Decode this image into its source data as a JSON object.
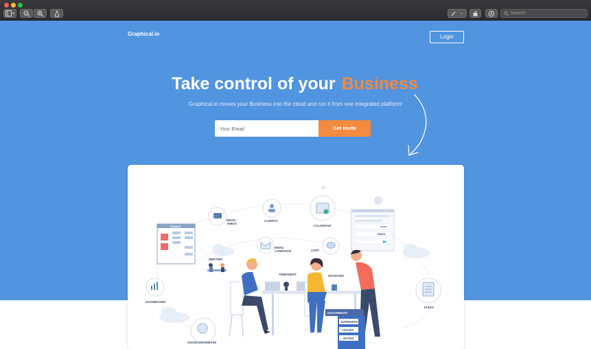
{
  "toolbar": {
    "search_placeholder": "Search"
  },
  "header": {
    "brand": "Graphical.io",
    "login_label": "Login"
  },
  "hero": {
    "headline": "Take control of your",
    "headline_highlight": "Business",
    "subline": "Graphical.io moves your Business into the cloud and run it from one integrated platform!",
    "email_placeholder": "Your Email",
    "cta_label": "Get Invite"
  },
  "illustration": {
    "labels": {
      "kanban": "KANBAN",
      "email_inbox_1": "EMAIL",
      "email_inbox_2": "INBOX",
      "clients": "CLIENTS",
      "calendar": "CALENDAR",
      "email_campaign_1": "EMAIL",
      "email_campaign_2": "CAMPAIGN",
      "chat": "CHAT",
      "meeting": "MEETING",
      "timesheet": "TIMESHEET",
      "invoicing": "INVOICING",
      "dashboard": "DASHBOARD",
      "documents": "DOCUMENTS",
      "expenses": "EXPENSES",
      "issues": "ISSUES",
      "notes": "NOTES",
      "tasks": "TASKS",
      "knowledgebase": "KNOWLEDGEBASE",
      "stripe": "stripe",
      "paypal": "PayPal"
    }
  },
  "colors": {
    "hero_bg": "#5194e0",
    "accent": "#f28a3f"
  }
}
